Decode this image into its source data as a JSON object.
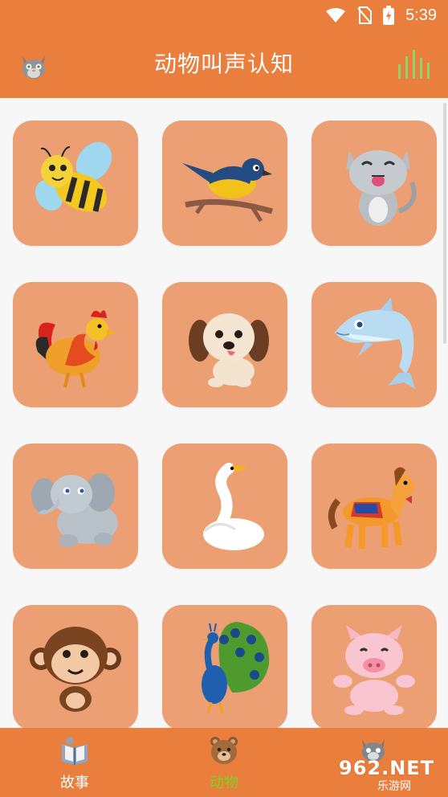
{
  "status_bar": {
    "time": "5:39"
  },
  "app_bar": {
    "title": "动物叫声认知"
  },
  "animals": [
    {
      "name": "bee"
    },
    {
      "name": "bird"
    },
    {
      "name": "cat"
    },
    {
      "name": "rooster"
    },
    {
      "name": "dog"
    },
    {
      "name": "dolphin"
    },
    {
      "name": "elephant"
    },
    {
      "name": "goose"
    },
    {
      "name": "horse"
    },
    {
      "name": "monkey"
    },
    {
      "name": "peacock"
    },
    {
      "name": "pig"
    }
  ],
  "bottom_nav": {
    "items": [
      {
        "label": "故事",
        "icon": "book-icon",
        "active": false
      },
      {
        "label": "动物",
        "icon": "bear-icon",
        "active": true
      },
      {
        "label": "",
        "icon": "cat-icon",
        "active": false
      }
    ]
  },
  "watermark": {
    "main": "962.NET",
    "sub": "乐游网"
  },
  "colors": {
    "primary": "#ea7e3d",
    "tile": "#eb9f72",
    "active_label": "#7ed321",
    "inactive_label": "#ffffff",
    "equalizer": "#8fd36a"
  }
}
